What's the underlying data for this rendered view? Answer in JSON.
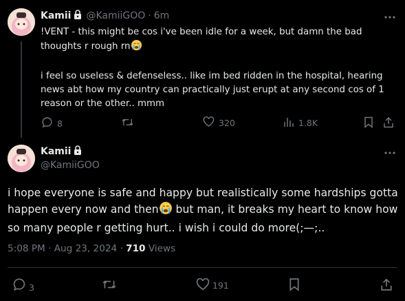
{
  "tweet1": {
    "author_name": "Kamii",
    "handle": "@KamiiGOO",
    "separator": "·",
    "time": "6m",
    "text_line1": "!VENT - this might be cos i've been idle for a week, but damn the bad thoughts r rough rn",
    "text_line2": "i feel so useless & defenseless.. like im bed ridden in the hospital, hearing news abt how my country can practically just erupt at any second cos of 1 reason or the other.. mmm",
    "replies": "8",
    "likes": "320",
    "views": "1.8K"
  },
  "tweet2": {
    "author_name": "Kamii",
    "handle": "@KamiiGOO",
    "text_part1": "i hope everyone is safe and happy but realistically some hardships gotta happen every now and then",
    "text_part2": " but man, it breaks my heart to know how so many people r getting hurt.. i wish i could do more(;—;..",
    "time": "5:08 PM · Aug 23, 2024 · ",
    "views_count": "710",
    "views_label": " Views",
    "replies": "3",
    "likes": "191"
  },
  "colors": {
    "background": "#000000",
    "text": "#e7e9ea",
    "muted": "#71767b",
    "divider": "#2f3336"
  },
  "icons": [
    "lock-icon",
    "more-icon",
    "reply-icon",
    "retweet-icon",
    "like-icon",
    "views-icon",
    "bookmark-icon",
    "share-icon",
    "crying-emoji"
  ]
}
